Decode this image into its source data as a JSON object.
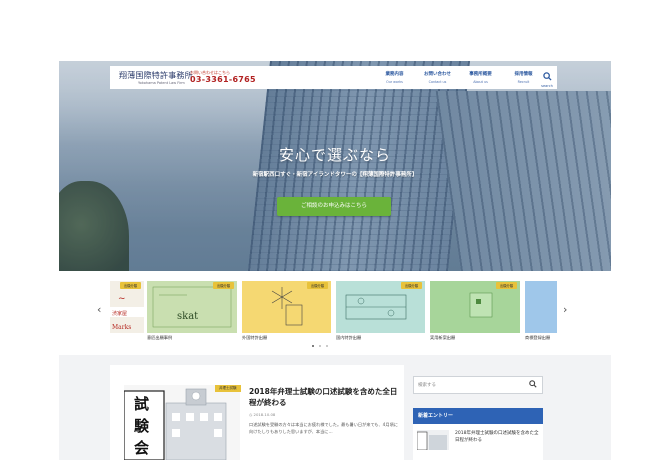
{
  "header": {
    "logo_name": "翔薄国際特許事務所",
    "logo_sub": "Yokohama Patent Law Firm",
    "tel_label": "お問い合わせはこちら",
    "tel": "03-3361-6765",
    "nav": [
      {
        "jp": "業務内容",
        "en": "Our works"
      },
      {
        "jp": "お問い合わせ",
        "en": "Contact us"
      },
      {
        "jp": "事務所概要",
        "en": "About us"
      },
      {
        "jp": "採用情報",
        "en": "Recruit"
      }
    ],
    "search_label": "search"
  },
  "hero": {
    "title": "安心で選ぶなら",
    "subtitle": "新宿駅西口すぐ・新宿アイランドタワーの【翔薄国際特許事務所】",
    "cta": "ご相談のお申込みはこちら"
  },
  "carousel": {
    "cards": [
      {
        "badge": "出願分類",
        "label": ""
      },
      {
        "badge": "出願分類",
        "label": "意匠出願事例"
      },
      {
        "badge": "出願分類",
        "label": "外国特許出願"
      },
      {
        "badge": "出願分類",
        "label": "国内特許出願"
      },
      {
        "badge": "出願分類",
        "label": "実用新案出願"
      },
      {
        "badge": "",
        "label": "商標登録出願"
      }
    ],
    "card0_text": "Marks",
    "card1_text": "skat",
    "dots": 3
  },
  "article": {
    "badge": "弁理士試験",
    "title": "2018年弁理士試験の口述試験を含めた全日程が終わる",
    "date": "2018.10.08",
    "excerpt": "口述試験を受験の方々は本当にお疲れ様でした。最も暑い日が来ても、4月頃に向けたしりもありした思いますが、本当に…",
    "thumb_text_1": "試",
    "thumb_text_2": "験",
    "thumb_text_3": "会"
  },
  "sidebar": {
    "search_placeholder": "検索する",
    "heading": "新着エントリー",
    "entry_title": "2018年弁理士試験の口述試験を含めた全日程が終わる"
  }
}
